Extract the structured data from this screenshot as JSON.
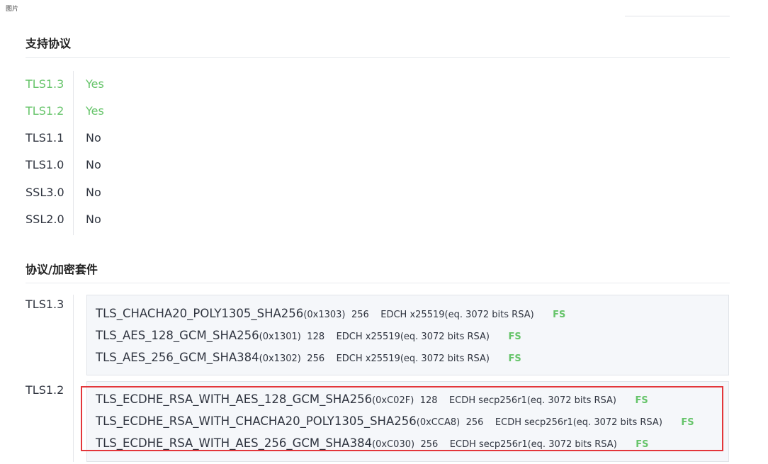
{
  "corner_label": "图片",
  "sections": {
    "protocols_title": "支持协议",
    "suites_title": "协议/加密套件"
  },
  "protocols": [
    {
      "name": "TLS1.3",
      "supported": "Yes",
      "color": "#66c46a"
    },
    {
      "name": "TLS1.2",
      "supported": "Yes",
      "color": "#66c46a"
    },
    {
      "name": "TLS1.1",
      "supported": "No",
      "color": "#303540"
    },
    {
      "name": "TLS1.0",
      "supported": "No",
      "color": "#303540"
    },
    {
      "name": "SSL3.0",
      "supported": "No",
      "color": "#303540"
    },
    {
      "name": "SSL2.0",
      "supported": "No",
      "color": "#303540"
    }
  ],
  "suite_groups": [
    {
      "protocol": "TLS1.3",
      "suites": [
        {
          "name": "TLS_CHACHA20_POLY1305_SHA256",
          "code": "(0x1303)",
          "bits": "256",
          "kex": "EDCH x25519(eq. 3072 bits RSA)",
          "fs": "FS"
        },
        {
          "name": "TLS_AES_128_GCM_SHA256",
          "code": "(0x1301)",
          "bits": "128",
          "kex": "EDCH x25519(eq. 3072 bits RSA)",
          "fs": "FS"
        },
        {
          "name": "TLS_AES_256_GCM_SHA384",
          "code": "(0x1302)",
          "bits": "256",
          "kex": "EDCH x25519(eq. 3072 bits RSA)",
          "fs": "FS"
        }
      ]
    },
    {
      "protocol": "TLS1.2",
      "suites": [
        {
          "name": "TLS_ECDHE_RSA_WITH_AES_128_GCM_SHA256",
          "code": "(0xC02F)",
          "bits": "128",
          "kex": "ECDH secp256r1(eq. 3072 bits RSA)",
          "fs": "FS"
        },
        {
          "name": "TLS_ECDHE_RSA_WITH_CHACHA20_POLY1305_SHA256",
          "code": "(0xCCA8)",
          "bits": "256",
          "kex": "ECDH secp256r1(eq. 3072 bits RSA)",
          "fs": "FS"
        },
        {
          "name": "TLS_ECDHE_RSA_WITH_AES_256_GCM_SHA384",
          "code": "(0xC030)",
          "bits": "256",
          "kex": "ECDH secp256r1(eq. 3072 bits RSA)",
          "fs": "FS"
        }
      ]
    }
  ],
  "colors": {
    "accent_green": "#66c46a",
    "highlight_red": "#e3363a",
    "box_bg": "#f5f7fa"
  }
}
